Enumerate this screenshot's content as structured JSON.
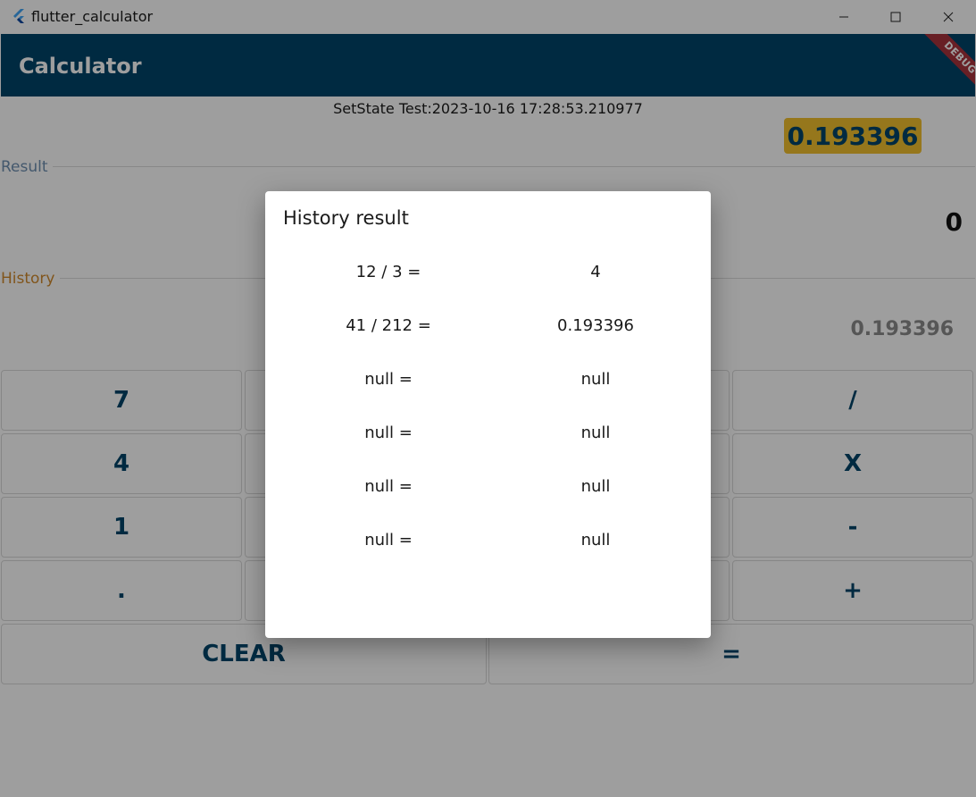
{
  "window": {
    "title": "flutter_calculator"
  },
  "appbar": {
    "title": "Calculator",
    "debug_banner": "DEBUG",
    "color": "#00456a"
  },
  "main": {
    "setstate_text": "SetState Test:2023-10-16 17:28:53.210977",
    "memo_value": "0.193396",
    "result_label": "Result",
    "result_value": "0",
    "history_label": "History",
    "history_value": "0.193396"
  },
  "keypad": {
    "row1": [
      "7",
      "",
      "",
      "/"
    ],
    "row2": [
      "4",
      "",
      "",
      "X"
    ],
    "row3": [
      "1",
      "",
      "",
      "-"
    ],
    "row4": [
      ".",
      "",
      "",
      "+"
    ],
    "clear_label": "CLEAR",
    "equals_label": "="
  },
  "dialog": {
    "title": "History result",
    "rows": [
      {
        "expr": "12 / 3 =",
        "result": "4"
      },
      {
        "expr": "41 / 212 =",
        "result": "0.193396"
      },
      {
        "expr": "null =",
        "result": "null"
      },
      {
        "expr": "null =",
        "result": "null"
      },
      {
        "expr": "null =",
        "result": "null"
      },
      {
        "expr": "null =",
        "result": "null"
      }
    ]
  },
  "colors": {
    "accent": "#00456a",
    "memo_chip": "#f2c12e",
    "debug_ribbon": "#a8323c"
  }
}
